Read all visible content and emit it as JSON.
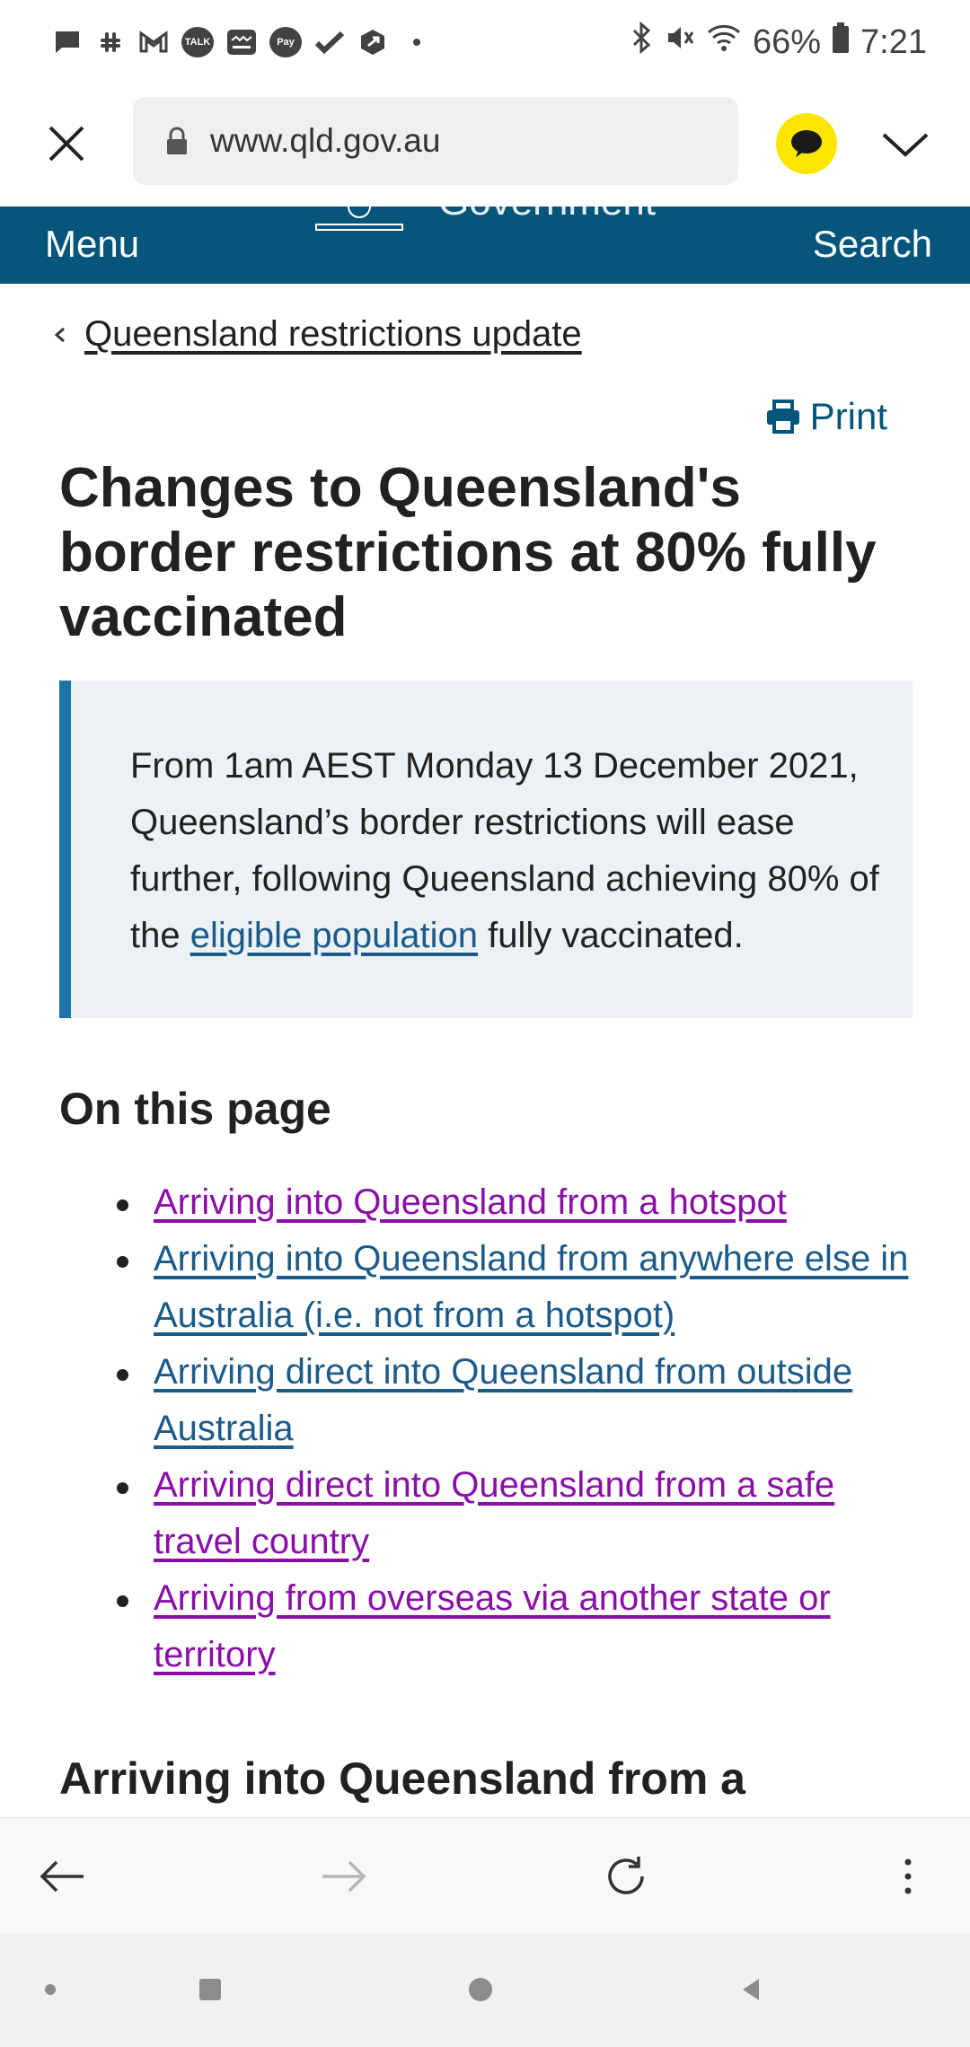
{
  "status_bar": {
    "talk_label": "TALK",
    "pay_label": "Pay",
    "battery": "66%",
    "time": "7:21"
  },
  "url_bar": {
    "url": "www.qld.gov.au"
  },
  "site_header": {
    "menu": "Menu",
    "government": "Government",
    "search": "Search"
  },
  "breadcrumb": {
    "label": "Queensland restrictions update"
  },
  "print": "Print",
  "title": "Changes to Queensland's border restrictions at 80% fully vaccinated",
  "callout": {
    "text_before": "From 1am AEST Monday 13 December 2021, Queensland’s border restrictions will ease further, following Queensland achieving 80% of the ",
    "link": "eligible population",
    "text_after": " fully vaccinated."
  },
  "on_this_page": {
    "heading": "On this page",
    "items": [
      {
        "label": "Arriving into Queensland from a hotspot",
        "visited": true
      },
      {
        "label": "Arriving into Queensland from anywhere else in Australia (i.e. not from a hotspot)",
        "visited": false
      },
      {
        "label": "Arriving direct into Queensland from outside Australia",
        "visited": false
      },
      {
        "label": "Arriving direct into Queensland from a safe travel country",
        "visited": true
      },
      {
        "label": "Arriving from overseas via another state or territory",
        "visited": true
      }
    ]
  },
  "section_heading": "Arriving into Queensland from a",
  "colors": {
    "header_bg": "#05567a",
    "callout_bg": "#ecf1f4",
    "callout_border": "#1b75a8",
    "link_visited": "#8a0fa8",
    "link_unvisited": "#1b5b89",
    "kakao": "#fde500"
  }
}
